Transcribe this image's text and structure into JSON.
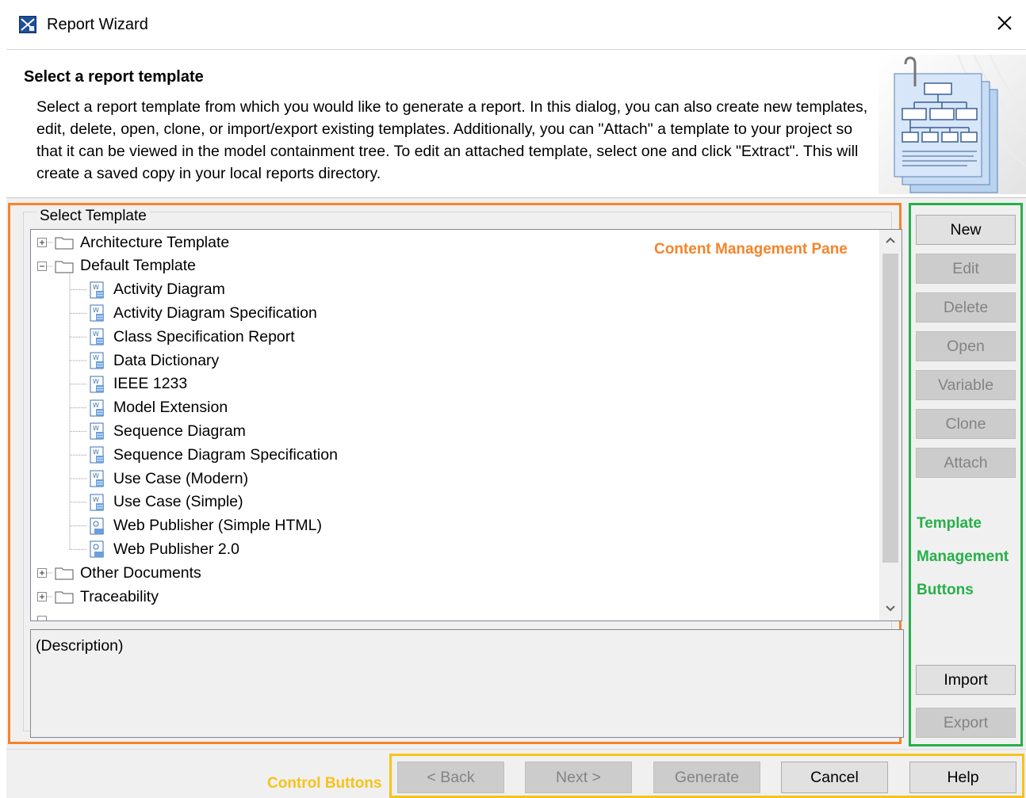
{
  "window": {
    "title": "Report Wizard"
  },
  "header": {
    "title": "Select a report template",
    "description": "Select a report template from which you would like to generate a report. In this dialog, you can also create new templates, edit, delete, open, clone, or import/export existing templates. Additionally, you can \"Attach\" a template to your project so that it can be viewed in the model containment tree. To edit an attached template, select one and click \"Extract\". This will create a saved copy in your local reports directory."
  },
  "template_group": {
    "label": "Select Template"
  },
  "annotations": {
    "content_pane": "Content Management Pane",
    "template_buttons": [
      "Template",
      "Management",
      "Buttons"
    ],
    "control_buttons": "Control Buttons"
  },
  "tree": [
    {
      "label": "Architecture Template",
      "kind": "folder",
      "expanded": false
    },
    {
      "label": "Default Template",
      "kind": "folder",
      "expanded": true
    },
    {
      "label": "Activity Diagram",
      "kind": "template"
    },
    {
      "label": "Activity Diagram Specification",
      "kind": "template"
    },
    {
      "label": "Class Specification Report",
      "kind": "template"
    },
    {
      "label": "Data Dictionary",
      "kind": "template"
    },
    {
      "label": "IEEE 1233",
      "kind": "template"
    },
    {
      "label": "Model Extension",
      "kind": "template"
    },
    {
      "label": "Sequence Diagram",
      "kind": "template"
    },
    {
      "label": "Sequence Diagram Specification",
      "kind": "template"
    },
    {
      "label": "Use Case (Modern)",
      "kind": "template"
    },
    {
      "label": "Use Case (Simple)",
      "kind": "template"
    },
    {
      "label": "Web Publisher (Simple HTML)",
      "kind": "web"
    },
    {
      "label": "Web Publisher 2.0",
      "kind": "web"
    },
    {
      "label": "Other Documents",
      "kind": "folder",
      "expanded": false
    },
    {
      "label": "Traceability",
      "kind": "folder",
      "expanded": false
    }
  ],
  "description_box": {
    "text": "(Description)"
  },
  "side_buttons": [
    {
      "label": "New",
      "enabled": true
    },
    {
      "label": "Edit",
      "enabled": false
    },
    {
      "label": "Delete",
      "enabled": false
    },
    {
      "label": "Open",
      "enabled": false
    },
    {
      "label": "Variable",
      "enabled": false
    },
    {
      "label": "Clone",
      "enabled": false
    },
    {
      "label": "Attach",
      "enabled": false
    },
    {
      "label": "Import",
      "enabled": true
    },
    {
      "label": "Export",
      "enabled": false
    }
  ],
  "control_buttons": [
    {
      "label": "< Back",
      "enabled": false
    },
    {
      "label": "Next >",
      "enabled": false
    },
    {
      "label": "Generate",
      "enabled": false
    },
    {
      "label": "Cancel",
      "enabled": true
    },
    {
      "label": "Help",
      "enabled": true
    }
  ],
  "colors": {
    "content_pane": "#f5842a",
    "template_buttons": "#26b04a",
    "control_buttons": "#f6c319"
  }
}
